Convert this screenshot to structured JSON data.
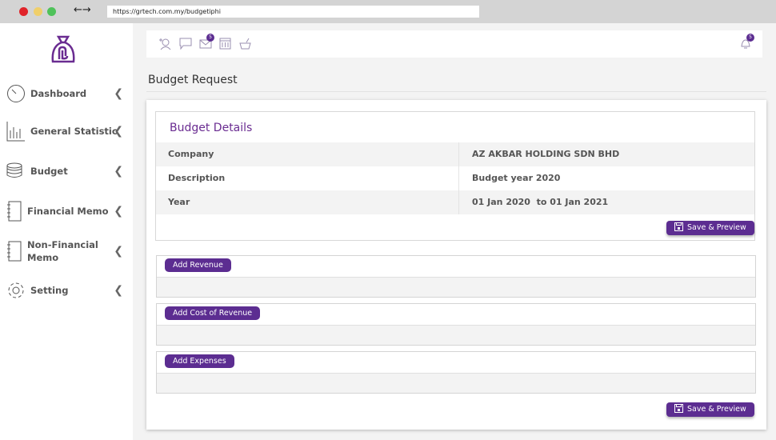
{
  "browser": {
    "url": "https://grtech.com.my/budgetiphi",
    "nav_arrows": "←→"
  },
  "sidebar": {
    "items": [
      {
        "label": "Dashboard",
        "icon": "gauge-icon"
      },
      {
        "label": "General Statistic",
        "icon": "chart-icon"
      },
      {
        "label": "Budget",
        "icon": "coins-icon"
      },
      {
        "label": "Financial Memo",
        "icon": "notebook-icon"
      },
      {
        "label": "Non-Financial",
        "label2": "Memo",
        "icon": "notebook-icon"
      },
      {
        "label": "Setting",
        "icon": "gear-icon"
      }
    ]
  },
  "topbar": {
    "mail_badge": "5",
    "notification_badge": "5"
  },
  "page": {
    "title": "Budget Request"
  },
  "details": {
    "title": "Budget Details",
    "rows": [
      {
        "label": "Company",
        "value": "AZ AKBAR HOLDING SDN BHD"
      },
      {
        "label": "Description",
        "value": "Budget year 2020"
      },
      {
        "label": "Year",
        "value": "01 Jan 2020  to 01 Jan 2021"
      }
    ],
    "save_label": "Save & Preview"
  },
  "sections": [
    {
      "label": "Add Revenue"
    },
    {
      "label": "Add Cost of Revenue"
    },
    {
      "label": "Add Expenses"
    }
  ],
  "footer": {
    "save_label": "Save & Preview"
  },
  "colors": {
    "accent": "#5c2d91",
    "title": "#6a2c91"
  }
}
